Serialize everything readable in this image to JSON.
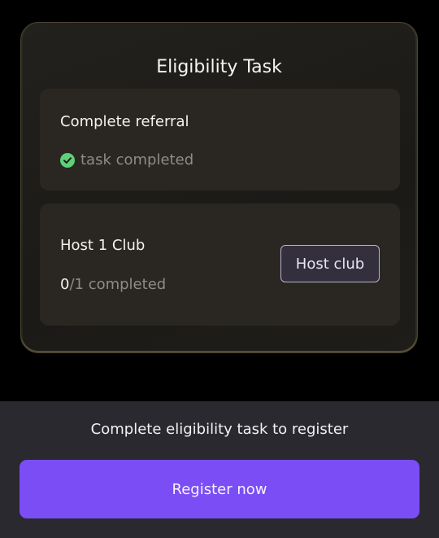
{
  "eligibility": {
    "title": "Eligibility Task",
    "tasks": [
      {
        "label": "Complete referral",
        "status": "task completed",
        "status_icon": "check-circle-icon"
      },
      {
        "label": "Host 1 Club",
        "progress_done": "0",
        "progress_rest": "/1 completed",
        "action_label": "Host club"
      }
    ]
  },
  "footer": {
    "message": "Complete eligibility task to register",
    "register_label": "Register now"
  },
  "colors": {
    "background": "#000000",
    "card_border": "#4a4433",
    "task_item_background": "#2a2722",
    "check_green": "#5fd07a",
    "accent_purple": "#7b4df5",
    "footer_background": "#2a2930"
  }
}
